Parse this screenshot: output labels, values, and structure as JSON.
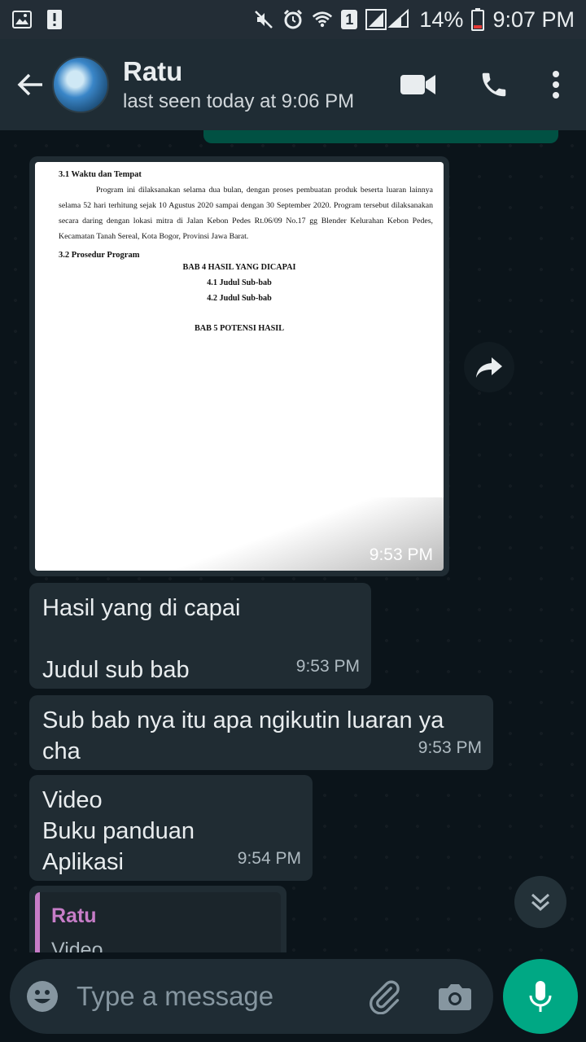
{
  "status_bar": {
    "battery": "14%",
    "time": "9:07 PM",
    "sim_badge": "1"
  },
  "header": {
    "contact_name": "Ratu",
    "last_seen": "last seen today at 9:06 PM"
  },
  "messages": {
    "image": {
      "time": "9:53 PM",
      "doc": {
        "heading1": "3.1 Waktu dan Tempat",
        "paragraph": "Program ini dilaksanakan selama dua bulan, dengan proses pembuatan produk beserta luaran lainnya selama 52 hari terhitung sejak 10 Agustus 2020 sampai dengan 30 September 2020. Program tersebut dilaksanakan secara daring dengan lokasi mitra di Jalan Kebon Pedes Rt.06/09 No.17 gg Blender Kelurahan Kebon Pedes, Kecamatan Tanah Sereal, Kota Bogor, Provinsi Jawa Barat.",
        "heading2": "3.2 Prosedur Program",
        "bab4": "BAB 4 HASIL YANG DICAPAI",
        "sub1": "4.1 Judul Sub-bab",
        "sub2": "4.2 Judul Sub-bab",
        "bab5": "BAB 5 POTENSI HASIL"
      }
    },
    "m1": {
      "line1": "Hasil yang di capai",
      "line2": "Judul sub bab",
      "time": "9:53 PM"
    },
    "m2": {
      "line1": "Sub bab nya itu apa ngikutin luaran ya",
      "line2": "cha",
      "time": "9:53 PM"
    },
    "m3": {
      "line1": "Video",
      "line2": "Buku panduan",
      "line3": "Aplikasi",
      "time": "9:54 PM"
    },
    "m4": {
      "quote_name": "Ratu",
      "quote_text": "Video"
    }
  },
  "input": {
    "placeholder": "Type a message"
  },
  "colors": {
    "accent": "#00a884",
    "bubble": "#202c33",
    "header": "#1f2c34",
    "quote_name": "#c77dc8"
  },
  "icons": [
    "gallery-icon",
    "alert-icon",
    "mute-icon",
    "alarm-icon",
    "wifi-icon",
    "signal-icon",
    "battery-icon",
    "back-arrow-icon",
    "video-call-icon",
    "phone-icon",
    "more-vert-icon",
    "forward-icon",
    "scroll-down-icon",
    "emoji-icon",
    "attach-icon",
    "camera-icon",
    "mic-icon"
  ]
}
